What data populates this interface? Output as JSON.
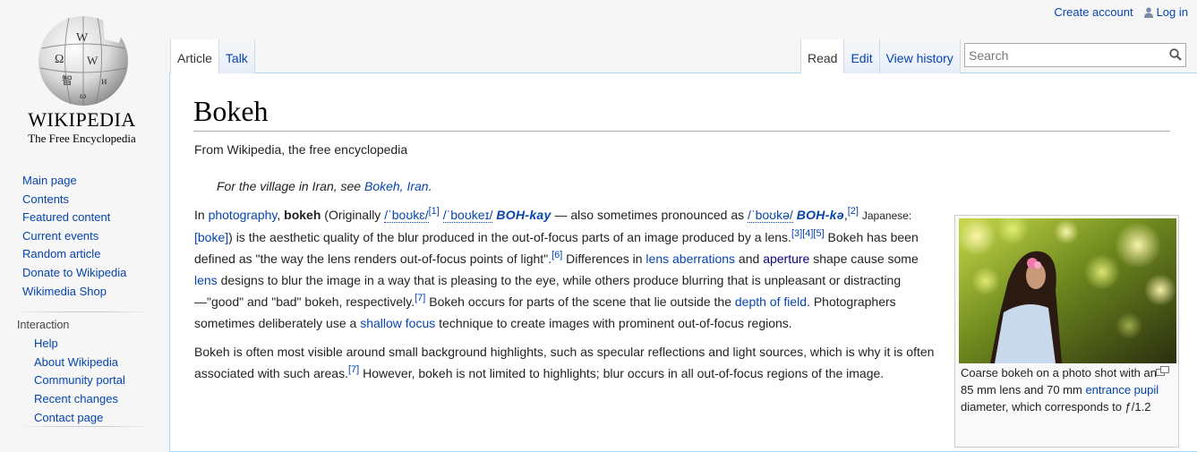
{
  "logo": {
    "wordmark": "WIKIPEDIA",
    "tagline": "The Free Encyclopedia"
  },
  "personal": {
    "create_account": "Create account",
    "login": "Log in"
  },
  "tabs": {
    "left": [
      {
        "label": "Article",
        "selected": true
      },
      {
        "label": "Talk",
        "selected": false
      }
    ],
    "right": [
      {
        "label": "Read",
        "selected": true
      },
      {
        "label": "Edit",
        "selected": false
      },
      {
        "label": "View history",
        "selected": false
      }
    ]
  },
  "search": {
    "placeholder": "Search",
    "icon": "search-icon"
  },
  "sidebar": {
    "main": [
      "Main page",
      "Contents",
      "Featured content",
      "Current events",
      "Random article",
      "Donate to Wikipedia",
      "Wikimedia Shop"
    ],
    "interaction_heading": "Interaction",
    "interaction": [
      "Help",
      "About Wikipedia",
      "Community portal",
      "Recent changes",
      "Contact page"
    ]
  },
  "article": {
    "title": "Bokeh",
    "site_sub": "From Wikipedia, the free encyclopedia",
    "hatnote": {
      "prefix": "For the village in Iran, see ",
      "link": "Bokeh, Iran",
      "suffix": "."
    },
    "p1": {
      "t1": "In ",
      "photography": "photography",
      "t2": ", ",
      "bokeh": "bokeh",
      "t3": " (Originally ",
      "ipa1": "/ˈboʊkɛ/",
      "ref1": "[1]",
      "t4": " ",
      "ipa2": "/ˈboʊkeɪ/",
      "resp1": "BOH-kay",
      "t5": " — also sometimes pronounced as ",
      "ipa3": "/ˈboʊkə/",
      "resp2": "BOH-kə",
      "ref2": "[2]",
      "japanese": "Japanese:",
      "boke": "[boke]",
      "t6": ") is the aesthetic quality of the blur produced in the out-of-focus parts of an image produced by a lens.",
      "ref3": "[3]",
      "ref4": "[4]",
      "ref5": "[5]",
      "t7": " Bokeh has been defined as \"the way the lens renders out-of-focus points of light\".",
      "ref6": "[6]",
      "t8": " Differences in ",
      "aberrations": "lens aberrations",
      "t9": " and ",
      "aperture": "aperture",
      "t10": " shape cause some ",
      "lens": "lens",
      "t11": " designs to blur the image in a way that is pleasing to the eye, while others produce blurring that is unpleasant or distracting—\"good\" and \"bad\" bokeh, respectively.",
      "ref7": "[7]",
      "t12": " Bokeh occurs for parts of the scene that lie outside the ",
      "dof": "depth of field",
      "t13": ". Photographers sometimes deliberately use a ",
      "shallow": "shallow focus",
      "t14": " technique to create images with prominent out-of-focus regions."
    },
    "p2": {
      "t1": "Bokeh is often most visible around small background highlights, such as specular reflections and light sources, which is why it is often associated with such areas.",
      "ref": "[7]",
      "t2": " However, bokeh is not limited to highlights; blur occurs in all out-of-focus regions of the image."
    },
    "thumb": {
      "c1": "Coarse bokeh on a photo shot with an 85 mm lens and 70 mm ",
      "link": "entrance pupil",
      "c2": " diameter, which corresponds to ",
      "fnum": "ƒ/1.2"
    }
  },
  "colors": {
    "link": "#0645ad",
    "border": "#a7d7f9",
    "background": "#f6f6f6"
  }
}
